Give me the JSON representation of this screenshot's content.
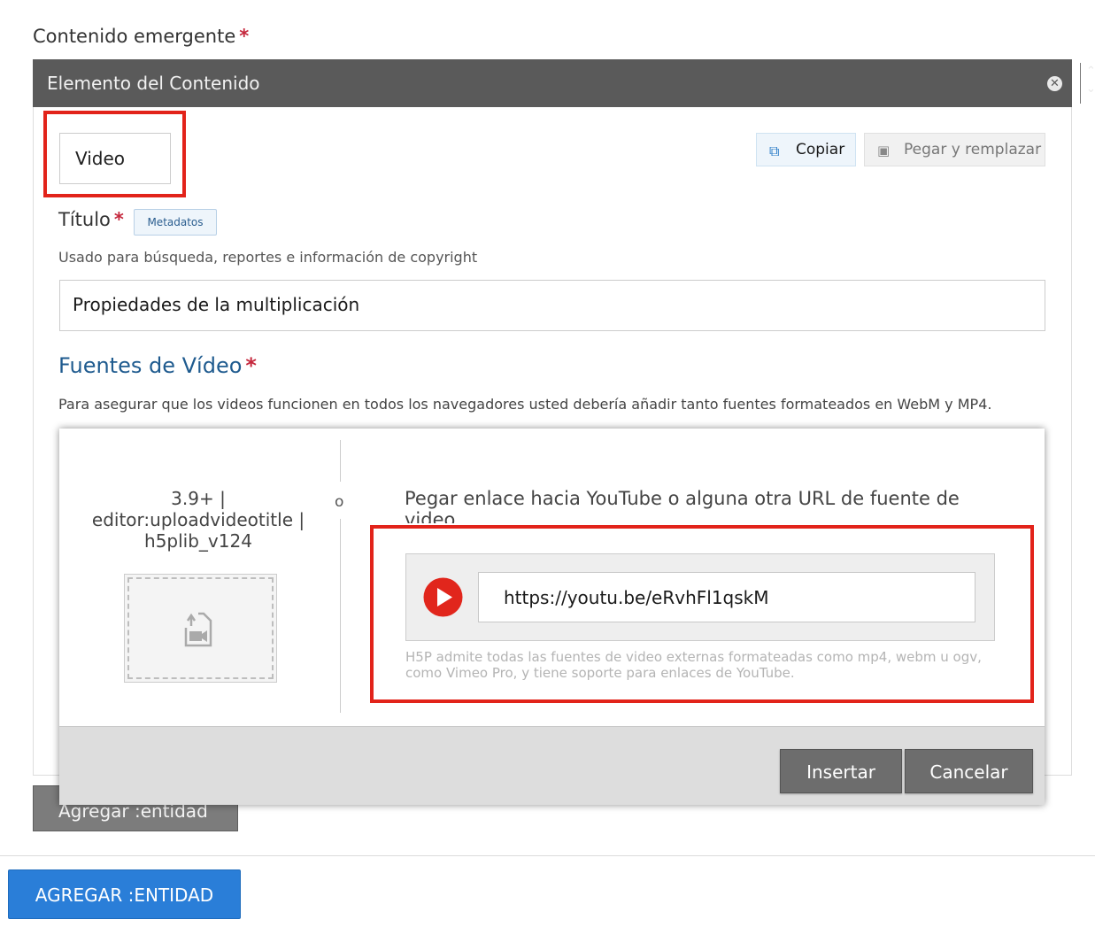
{
  "form": {
    "field_label": "Contenido emergente",
    "required_mark": "*",
    "add_entity_label": "Agregar :entidad",
    "submit_label": "AGREGAR :ENTIDAD"
  },
  "element": {
    "header_title": "Elemento del Contenido",
    "remove_icon": "close-circle-icon",
    "order_icons": [
      "chevron-up-icon",
      "chevron-down-icon"
    ],
    "library_value": "Video",
    "copy_label": "Copiar",
    "paste_label": "Pegar y remplazar"
  },
  "titulo": {
    "label": "Título",
    "metadata_label": "Metadatos",
    "description": "Usado para búsqueda, reportes e información de copyright",
    "value": "Propiedades de la multiplicación"
  },
  "fuentes": {
    "title": "Fuentes de Vídeo",
    "description": "Para asegurar que los videos funcionen en todos los navegadores usted debería añadir tanto fuentes formateados en WebM y MP4."
  },
  "dialog": {
    "upload_title": "3.9+ | editor:uploadvideotitle | h5plib_v124",
    "or_text": "o",
    "paste_title": "Pegar enlace hacia YouTube o alguna otra URL de fuente de video",
    "url_value": "https://youtu.be/eRvhFl1qskM",
    "help_text": "H5P admite todas las fuentes de video externas formateadas como mp4, webm u ogv, como Vimeo Pro, y tiene soporte para enlaces de YouTube.",
    "insert_label": "Insertar",
    "cancel_label": "Cancelar"
  },
  "colors": {
    "highlight": "#e2231a",
    "youtube_red": "#e1261c",
    "primary_button": "#2a7ed8",
    "header_bg": "#5a5a5a",
    "section_title": "#1f5b8f"
  }
}
